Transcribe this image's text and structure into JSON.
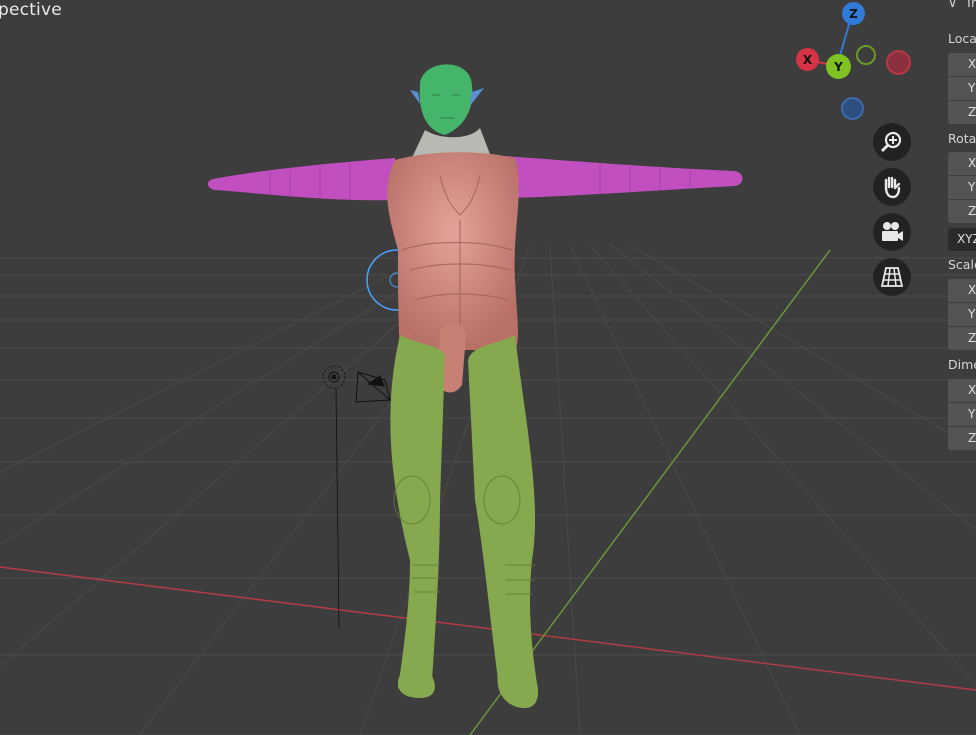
{
  "viewport": {
    "title": "pective",
    "background": "#3d3d3d",
    "axis_x_color": "#b83c46",
    "axis_y_color": "#6e9a3a"
  },
  "gizmo": {
    "z_label": "Z",
    "x_label": "X",
    "y_label": "Y",
    "z_color": "#2f7bd7",
    "x_color": "#d63346",
    "y_color": "#7ec321"
  },
  "nav_buttons": [
    {
      "icon": "zoom-in-icon"
    },
    {
      "icon": "hand-pan-icon"
    },
    {
      "icon": "camera-icon"
    },
    {
      "icon": "grid-ortho-icon"
    }
  ],
  "transform_panel": {
    "header": "Tr",
    "location_label": "Loca",
    "rotation_label": "Rota",
    "scale_label": "Scale",
    "dimensions_label": "Dime",
    "axes": [
      "X",
      "Y",
      "Z"
    ],
    "rotation_mode": "XYZ"
  },
  "model_colors": {
    "head": "#45b56a",
    "arms": "#c14fc0",
    "torso": "#d98c83",
    "legs": "#86a84e",
    "neck": "#b9b9b4"
  }
}
